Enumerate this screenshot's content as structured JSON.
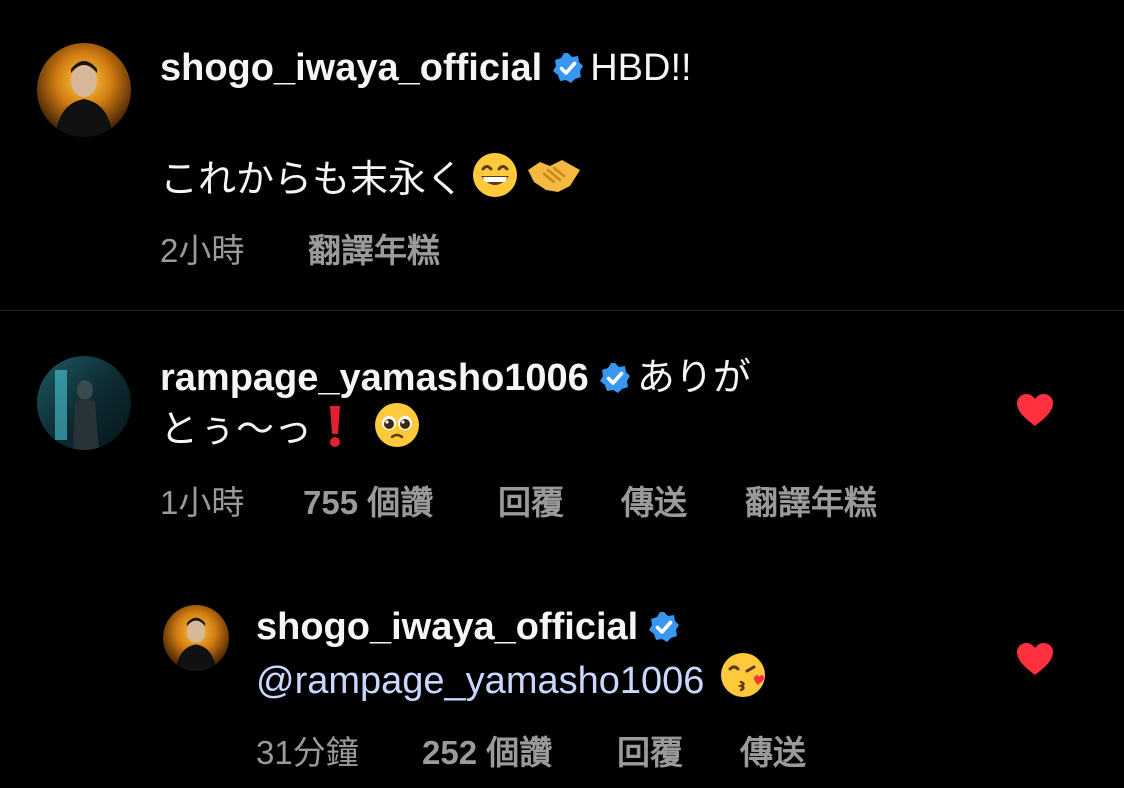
{
  "comments": [
    {
      "username": "shogo_iwaya_official",
      "text_line1": "HBD!!",
      "text_line2": "これからも末永く",
      "time": "2小時",
      "translate": "翻譯年糕"
    },
    {
      "username": "rampage_yamasho1006",
      "text_line1": "ありが",
      "text_line2": "とぅ〜っ",
      "time": "1小時",
      "likes": "755 個讚",
      "reply": "回覆",
      "send": "傳送",
      "translate": "翻譯年糕"
    }
  ],
  "reply": {
    "username": "shogo_iwaya_official",
    "mention": "@rampage_yamasho1006",
    "time": "31分鐘",
    "likes": "252 個讚",
    "reply": "回覆",
    "send": "傳送"
  },
  "colors": {
    "background": "#000000",
    "verified": "#3897f0",
    "heart": "#ff3040",
    "meta": "#9a9a9a"
  },
  "icons": [
    "verified-badge-icon",
    "grinning-face-emoji",
    "handshake-emoji",
    "exclamation-emoji",
    "pleading-face-emoji",
    "kissing-face-emoji",
    "heart-icon"
  ]
}
